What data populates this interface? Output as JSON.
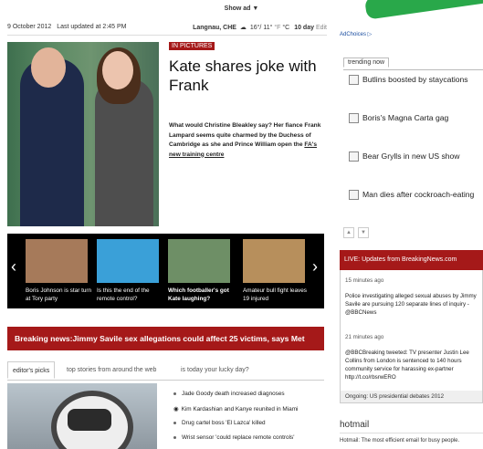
{
  "top": {
    "show_ad": "Show ad ▼"
  },
  "datebar": {
    "date": "9 October 2012",
    "updated": "Last updated at 2:45 PM",
    "location": "Langnau, CHE",
    "temp": "16°/ 11°",
    "units_f": "°F",
    "units_c": "°C",
    "forecast": "10 day",
    "edit": "Edit"
  },
  "lead": {
    "badge": "IN PICTURES",
    "headline": "Kate shares joke with Frank",
    "teaser": "What would Christine Bleakley say? Her fiance Frank Lampard seems quite charmed by the Duchess of Cambridge as she and Prince William open the ",
    "teaser_link": "FA's new training centre"
  },
  "carousel": [
    {
      "caption": "Boris Johnson is star turn at Tory party",
      "bold": false,
      "color": "#a67a5a"
    },
    {
      "caption": "Is this the end of the remote control?",
      "bold": false,
      "color": "#3aa0d8"
    },
    {
      "caption": "Which footballer's got Kate laughing?",
      "bold": true,
      "color": "#6e8f66"
    },
    {
      "caption": "Amateur bull fight leaves 19 injured",
      "bold": false,
      "color": "#b78f5c"
    }
  ],
  "breaking": "Breaking news:Jimmy Savile sex allegations could affect 25 victims, says Met",
  "tabs": [
    "editor's picks",
    "top stories from around the web",
    "is today your lucky day?"
  ],
  "stories": [
    "Jade Goody death increased diagnoses",
    "Kim Kardashian and Kanye reunited in Miami",
    "Drug cartel boss 'El Lazca' killed",
    "Wrist sensor 'could replace remote controls'"
  ],
  "sidebar": {
    "adchoices": "AdChoices ▷",
    "trending_tab": "trending now",
    "trending": [
      "Butlins boosted by staycations",
      "Boris's Magna Carta gag",
      "Bear Grylls in new US show",
      "Man dies after cockroach-eating"
    ],
    "live_title": "LIVE: Updates from BreakingNews.com",
    "live_items": [
      {
        "time": "15 minutes ago",
        "text": "Police investigating alleged sexual abuses by Jimmy Savile are pursuing 120 separate lines of inquiry - @BBCNews"
      },
      {
        "time": "21 minutes ago",
        "text": "@BBCBreaking tweeted: TV presenter Justin Lee Collins from London is sentenced to 140 hours community service for harassing ex-partner http://t.co/rbsrwERO"
      }
    ],
    "ongoing": "Ongoing:  US presidential debates 2012",
    "hotmail_title": "hotmail",
    "hotmail_text": "Hotmail: The most efficient email for busy people."
  },
  "colors": {
    "brand_red": "#a51919",
    "link_blue": "#1a4da0"
  }
}
